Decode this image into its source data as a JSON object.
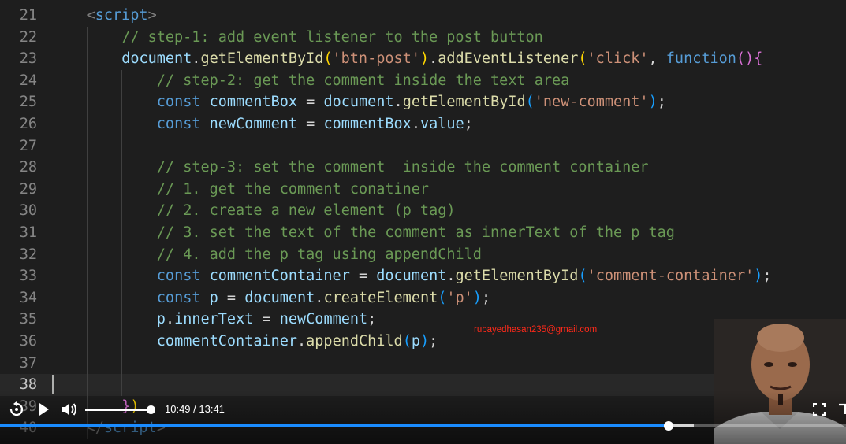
{
  "editor": {
    "lines": [
      {
        "num": "21",
        "indent": 4,
        "tokens": [
          {
            "t": "<",
            "c": "punc"
          },
          {
            "t": "script",
            "c": "tag"
          },
          {
            "t": ">",
            "c": "punc"
          }
        ]
      },
      {
        "num": "22",
        "indent": 8,
        "tokens": [
          {
            "t": "// step-1: add event listener to the post button",
            "c": "comment"
          }
        ]
      },
      {
        "num": "23",
        "indent": 8,
        "tokens": [
          {
            "t": "document",
            "c": "var"
          },
          {
            "t": ".",
            "c": "plain"
          },
          {
            "t": "getElementById",
            "c": "func"
          },
          {
            "t": "(",
            "c": "b1"
          },
          {
            "t": "'btn-post'",
            "c": "string"
          },
          {
            "t": ")",
            "c": "b1"
          },
          {
            "t": ".",
            "c": "plain"
          },
          {
            "t": "addEventListener",
            "c": "func"
          },
          {
            "t": "(",
            "c": "b1"
          },
          {
            "t": "'click'",
            "c": "string"
          },
          {
            "t": ", ",
            "c": "plain"
          },
          {
            "t": "function",
            "c": "keyword"
          },
          {
            "t": "()",
            "c": "b2"
          },
          {
            "t": "{",
            "c": "b2"
          }
        ]
      },
      {
        "num": "24",
        "indent": 12,
        "tokens": [
          {
            "t": "// step-2: get the comment inside the text area",
            "c": "comment"
          }
        ]
      },
      {
        "num": "25",
        "indent": 12,
        "tokens": [
          {
            "t": "const ",
            "c": "keyword"
          },
          {
            "t": "commentBox",
            "c": "var"
          },
          {
            "t": " = ",
            "c": "plain"
          },
          {
            "t": "document",
            "c": "var"
          },
          {
            "t": ".",
            "c": "plain"
          },
          {
            "t": "getElementById",
            "c": "func"
          },
          {
            "t": "(",
            "c": "b3"
          },
          {
            "t": "'new-comment'",
            "c": "string"
          },
          {
            "t": ")",
            "c": "b3"
          },
          {
            "t": ";",
            "c": "plain"
          }
        ]
      },
      {
        "num": "26",
        "indent": 12,
        "tokens": [
          {
            "t": "const ",
            "c": "keyword"
          },
          {
            "t": "newComment",
            "c": "var"
          },
          {
            "t": " = ",
            "c": "plain"
          },
          {
            "t": "commentBox",
            "c": "var"
          },
          {
            "t": ".",
            "c": "plain"
          },
          {
            "t": "value",
            "c": "var"
          },
          {
            "t": ";",
            "c": "plain"
          }
        ]
      },
      {
        "num": "27",
        "indent": 0,
        "tokens": []
      },
      {
        "num": "28",
        "indent": 12,
        "tokens": [
          {
            "t": "// step-3: set the comment  inside the comment container",
            "c": "comment"
          }
        ]
      },
      {
        "num": "29",
        "indent": 12,
        "tokens": [
          {
            "t": "// 1. get the comment conatiner",
            "c": "comment"
          }
        ]
      },
      {
        "num": "30",
        "indent": 12,
        "tokens": [
          {
            "t": "// 2. create a new element (p tag)",
            "c": "comment"
          }
        ]
      },
      {
        "num": "31",
        "indent": 12,
        "tokens": [
          {
            "t": "// 3. set the text of the comment as innerText of the p tag",
            "c": "comment"
          }
        ]
      },
      {
        "num": "32",
        "indent": 12,
        "tokens": [
          {
            "t": "// 4. add the p tag using appendChild",
            "c": "comment"
          }
        ]
      },
      {
        "num": "33",
        "indent": 12,
        "tokens": [
          {
            "t": "const ",
            "c": "keyword"
          },
          {
            "t": "commentContainer",
            "c": "var"
          },
          {
            "t": " = ",
            "c": "plain"
          },
          {
            "t": "document",
            "c": "var"
          },
          {
            "t": ".",
            "c": "plain"
          },
          {
            "t": "getElementById",
            "c": "func"
          },
          {
            "t": "(",
            "c": "b3"
          },
          {
            "t": "'comment-container'",
            "c": "string"
          },
          {
            "t": ")",
            "c": "b3"
          },
          {
            "t": ";",
            "c": "plain"
          }
        ]
      },
      {
        "num": "34",
        "indent": 12,
        "tokens": [
          {
            "t": "const ",
            "c": "keyword"
          },
          {
            "t": "p",
            "c": "var"
          },
          {
            "t": " = ",
            "c": "plain"
          },
          {
            "t": "document",
            "c": "var"
          },
          {
            "t": ".",
            "c": "plain"
          },
          {
            "t": "createElement",
            "c": "func"
          },
          {
            "t": "(",
            "c": "b3"
          },
          {
            "t": "'p'",
            "c": "string"
          },
          {
            "t": ")",
            "c": "b3"
          },
          {
            "t": ";",
            "c": "plain"
          }
        ]
      },
      {
        "num": "35",
        "indent": 12,
        "tokens": [
          {
            "t": "p",
            "c": "var"
          },
          {
            "t": ".",
            "c": "plain"
          },
          {
            "t": "innerText",
            "c": "var"
          },
          {
            "t": " = ",
            "c": "plain"
          },
          {
            "t": "newComment",
            "c": "var"
          },
          {
            "t": ";",
            "c": "plain"
          }
        ]
      },
      {
        "num": "36",
        "indent": 12,
        "tokens": [
          {
            "t": "commentContainer",
            "c": "var"
          },
          {
            "t": ".",
            "c": "plain"
          },
          {
            "t": "appendChild",
            "c": "func"
          },
          {
            "t": "(",
            "c": "b3"
          },
          {
            "t": "p",
            "c": "var"
          },
          {
            "t": ")",
            "c": "b3"
          },
          {
            "t": ";",
            "c": "plain"
          }
        ]
      },
      {
        "num": "37",
        "indent": 0,
        "tokens": []
      },
      {
        "num": "38",
        "indent": 0,
        "tokens": [],
        "current": true
      },
      {
        "num": "39",
        "indent": 8,
        "tokens": [
          {
            "t": "}",
            "c": "b2"
          },
          {
            "t": ")",
            "c": "b1"
          }
        ]
      },
      {
        "num": "40",
        "indent": 4,
        "tokens": [
          {
            "t": "</",
            "c": "punc"
          },
          {
            "t": "script",
            "c": "tag"
          },
          {
            "t": ">",
            "c": "punc"
          }
        ]
      }
    ]
  },
  "watermark": "rubayedhasan235@gmail.com",
  "player": {
    "time_label": "10:49 / 13:41",
    "current_seconds": 649,
    "duration_seconds": 821,
    "buffered_fraction": 0.82,
    "volume_fraction": 1.0,
    "accent_color": "#1a8cff",
    "icons": {
      "replay": "replay-icon",
      "play": "play-icon",
      "volume": "volume-icon",
      "fullscreen": "fullscreen-icon",
      "expand": "expand-icon"
    }
  }
}
